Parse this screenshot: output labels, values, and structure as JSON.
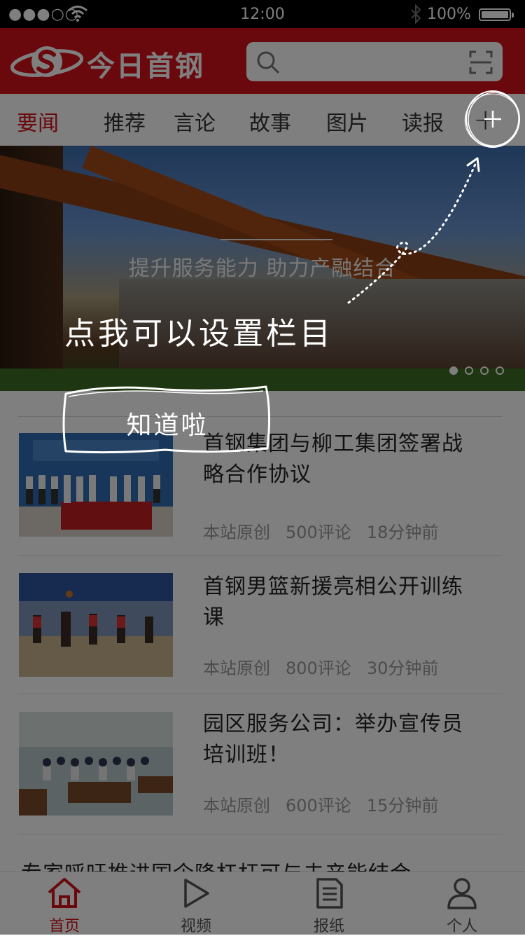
{
  "status_bar": {
    "signal": "●●●○○",
    "time": "12:00",
    "battery": "100%"
  },
  "header": {
    "logo_text": "今日首钢",
    "search_placeholder": ""
  },
  "tabs": [
    {
      "label": "要闻",
      "active": true
    },
    {
      "label": "推荐",
      "active": false
    },
    {
      "label": "言论",
      "active": false
    },
    {
      "label": "故事",
      "active": false
    },
    {
      "label": "图片",
      "active": false
    },
    {
      "label": "读报",
      "active": false
    }
  ],
  "banner": {
    "caption": "提升服务能力 助力产融结合",
    "page_count": 4,
    "current_page": 1
  },
  "news": [
    {
      "title": "首钢集团与柳工集团签署战略合作协议",
      "source": "本站原创",
      "comments": "500评论",
      "time": "18分钟前"
    },
    {
      "title": "首钢男篮新援亮相公开训练课",
      "source": "本站原创",
      "comments": "800评论",
      "time": "30分钟前"
    },
    {
      "title": "园区服务公司：举办宣传员培训班！",
      "source": "本站原创",
      "comments": "600评论",
      "time": "15分钟前"
    },
    {
      "title": "专家呼吁推进国企降杠杆可与去产能结合"
    }
  ],
  "bottom_nav": [
    {
      "label": "首页",
      "icon": "home-icon",
      "active": true
    },
    {
      "label": "视频",
      "icon": "play-icon",
      "active": false
    },
    {
      "label": "报纸",
      "icon": "newspaper-icon",
      "active": false
    },
    {
      "label": "个人",
      "icon": "person-icon",
      "active": false
    }
  ],
  "guide": {
    "hint": "点我可以设置栏目",
    "dismiss": "知道啦"
  },
  "colors": {
    "brand_red": "#d5121b",
    "overlay": "rgba(0,0,0,0.5)"
  }
}
